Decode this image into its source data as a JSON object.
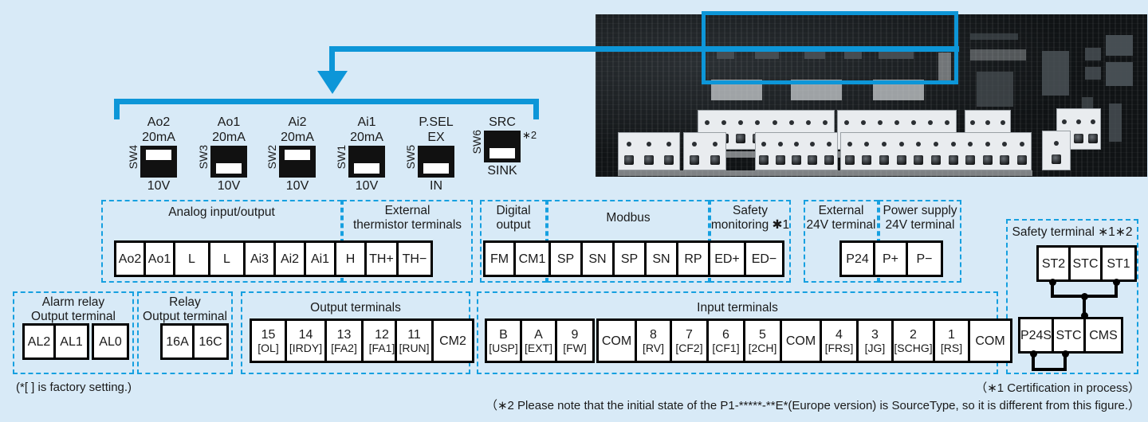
{
  "background_color": "#d8eaf7",
  "accent_color": "#0d96d8",
  "photo": {
    "alt": "inverter control terminal board photo",
    "highlight_box_name": "dip-switch-area-highlight"
  },
  "switches": [
    {
      "name": "SW4",
      "top_label": "Ao2",
      "on_label": "20mA",
      "off_label": "10V",
      "position": "up",
      "note": ""
    },
    {
      "name": "SW3",
      "top_label": "Ao1",
      "on_label": "20mA",
      "off_label": "10V",
      "position": "down",
      "note": ""
    },
    {
      "name": "SW2",
      "top_label": "Ai2",
      "on_label": "20mA",
      "off_label": "10V",
      "position": "up",
      "note": ""
    },
    {
      "name": "SW1",
      "top_label": "Ai1",
      "on_label": "20mA",
      "off_label": "10V",
      "position": "down",
      "note": ""
    },
    {
      "name": "SW5",
      "top_label": "P.SEL",
      "on_label": "EX",
      "off_label": "IN",
      "position": "down",
      "note": ""
    },
    {
      "name": "SW6",
      "top_label": "",
      "on_label": "SRC",
      "off_label": "SINK",
      "position": "down",
      "note": "∗2"
    }
  ],
  "groups": {
    "analog": "Analog input/output",
    "thermistor": "External\nthermistor terminals",
    "digital_output": "Digital\noutput",
    "modbus": "Modbus",
    "safety_monitoring": "Safety\nmonitoring ∗1",
    "external_24v": "External\n24V terminal",
    "power_supply_24v": "Power supply\n24V terminal",
    "safety_terminal": "Safety terminal ∗1∗2",
    "alarm_relay": "Alarm relay\nOutput terminal",
    "relay": "Relay\nOutput terminal",
    "output_terminals": "Output terminals",
    "input_terminals": "Input terminals"
  },
  "terminals": {
    "analog": [
      "Ao2",
      "Ao1",
      "L",
      "L",
      "Ai3",
      "Ai2",
      "Ai1",
      "H"
    ],
    "thermistor": [
      "TH+",
      "TH−"
    ],
    "digital_output": [
      "FM",
      "CM1"
    ],
    "modbus": [
      "SP",
      "SN",
      "SP",
      "SN",
      "RP"
    ],
    "safety_monitoring": [
      "ED+",
      "ED−"
    ],
    "external_24v": [
      "P24"
    ],
    "power_supply_24v": [
      "P+",
      "P−"
    ],
    "safety_top": [
      "ST2",
      "STC",
      "ST1"
    ],
    "safety_bottom": [
      "P24S",
      "STC",
      "CMS"
    ],
    "alarm_relay_a": [
      "AL2",
      "AL1"
    ],
    "alarm_relay_b": [
      "AL0"
    ],
    "relay": [
      "16A",
      "16C"
    ],
    "output_a": [
      {
        "num": "15",
        "func": "[OL]"
      },
      {
        "num": "14",
        "func": "[IRDY]"
      },
      {
        "num": "13",
        "func": "[FA2]"
      },
      {
        "num": "12",
        "func": "[FA1]"
      }
    ],
    "output_b": [
      {
        "num": "11",
        "func": "[RUN]"
      },
      {
        "num": "CM2",
        "func": ""
      }
    ],
    "input_a": [
      {
        "num": "B",
        "func": "[USP]"
      },
      {
        "num": "A",
        "func": "[EXT]"
      },
      {
        "num": "9",
        "func": "[FW]"
      }
    ],
    "input_b": [
      {
        "num": "COM",
        "func": ""
      },
      {
        "num": "8",
        "func": "[RV]"
      },
      {
        "num": "7",
        "func": "[CF2]"
      },
      {
        "num": "6",
        "func": "[CF1]"
      },
      {
        "num": "5",
        "func": "[2CH]"
      },
      {
        "num": "COM",
        "func": ""
      },
      {
        "num": "4",
        "func": "[FRS]"
      },
      {
        "num": "3",
        "func": "[JG]"
      },
      {
        "num": "2",
        "func": "[SCHG]"
      },
      {
        "num": "1",
        "func": "[RS]"
      },
      {
        "num": "COM",
        "func": ""
      }
    ]
  },
  "notes": {
    "factory": "(*[ ] is factory setting.)",
    "star1": "（∗1 Certification in process）",
    "star2": "（∗2 Please note that the initial state of the P1-*****-**E*(Europe version) is SourceType, so it is different from this figure.）"
  }
}
